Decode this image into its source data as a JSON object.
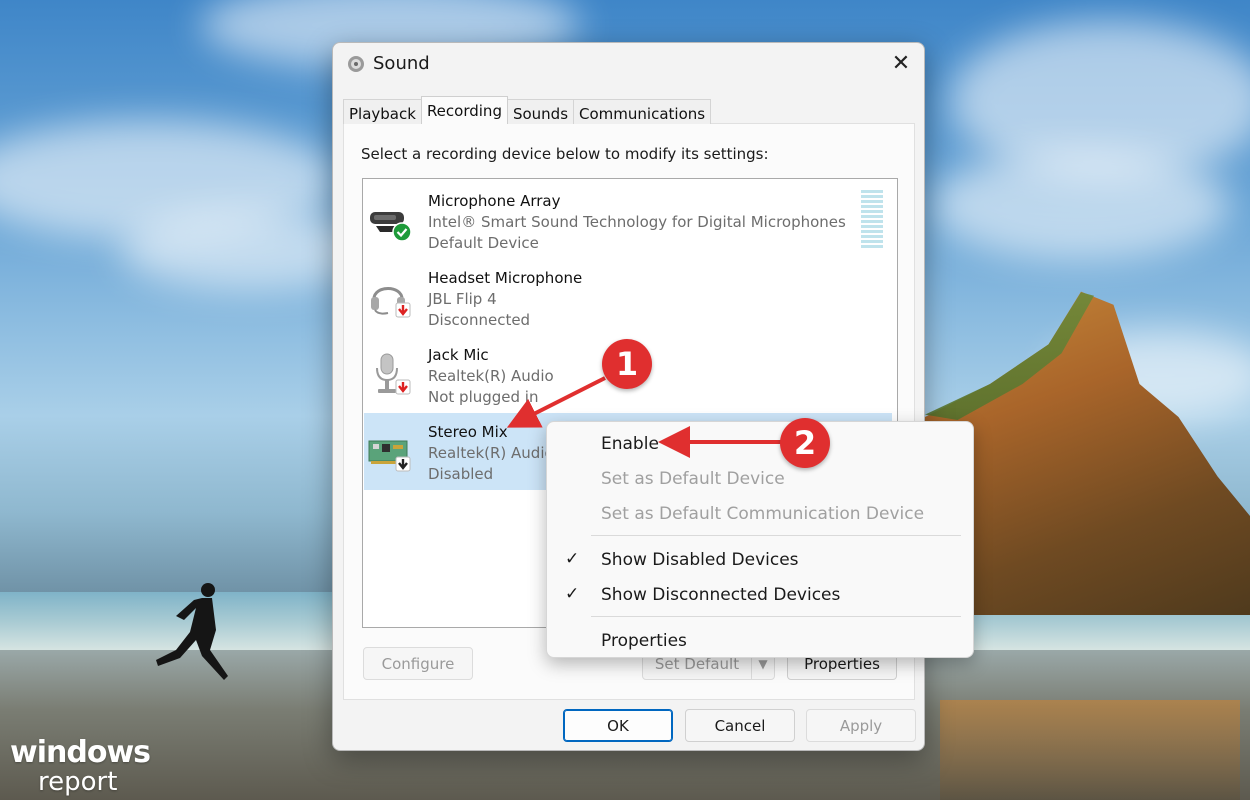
{
  "window": {
    "title": "Sound",
    "close_glyph": "✕"
  },
  "tabs": [
    {
      "label": "Playback",
      "active": false
    },
    {
      "label": "Recording",
      "active": true
    },
    {
      "label": "Sounds",
      "active": false
    },
    {
      "label": "Communications",
      "active": false
    }
  ],
  "recording": {
    "instruction": "Select a recording device below to modify its settings:",
    "devices": [
      {
        "name": "Microphone Array",
        "description": "Intel® Smart Sound Technology for Digital Microphones",
        "status": "Default Device",
        "icon": "microphone-array-icon",
        "state_icon": "check-badge-icon",
        "selected": false
      },
      {
        "name": "Headset Microphone",
        "description": "JBL Flip 4",
        "status": "Disconnected",
        "icon": "headset-icon",
        "state_icon": "down-arrow-red-badge-icon",
        "selected": false
      },
      {
        "name": "Jack Mic",
        "description": "Realtek(R) Audio",
        "status": "Not plugged in",
        "icon": "jack-mic-icon",
        "state_icon": "down-arrow-red-badge-icon",
        "selected": false
      },
      {
        "name": "Stereo Mix",
        "description": "Realtek(R) Audio",
        "status": "Disabled",
        "icon": "sound-card-icon",
        "state_icon": "down-arrow-black-badge-icon",
        "selected": true
      }
    ]
  },
  "buttons": {
    "configure": "Configure",
    "set_default": "Set Default",
    "set_default_arrow": "▼",
    "properties": "Properties",
    "ok": "OK",
    "cancel": "Cancel",
    "apply": "Apply"
  },
  "context_menu": {
    "items": [
      {
        "label": "Enable",
        "enabled": true,
        "checked": false
      },
      {
        "label": "Set as Default Device",
        "enabled": false,
        "checked": false
      },
      {
        "label": "Set as Default Communication Device",
        "enabled": false,
        "checked": false
      },
      {
        "label": "Show Disabled Devices",
        "enabled": true,
        "checked": true
      },
      {
        "label": "Show Disconnected Devices",
        "enabled": true,
        "checked": true
      },
      {
        "label": "Properties",
        "enabled": true,
        "checked": false
      }
    ],
    "check_glyph": "✓"
  },
  "annotations": {
    "badge_1": "1",
    "badge_2": "2",
    "color": "#e02f2f"
  },
  "watermark": {
    "line1": "windows",
    "line2": "report"
  },
  "colors": {
    "selected_row": "#cce4f7",
    "accent": "#0067c0",
    "disabled_text": "#a0a0a0"
  }
}
